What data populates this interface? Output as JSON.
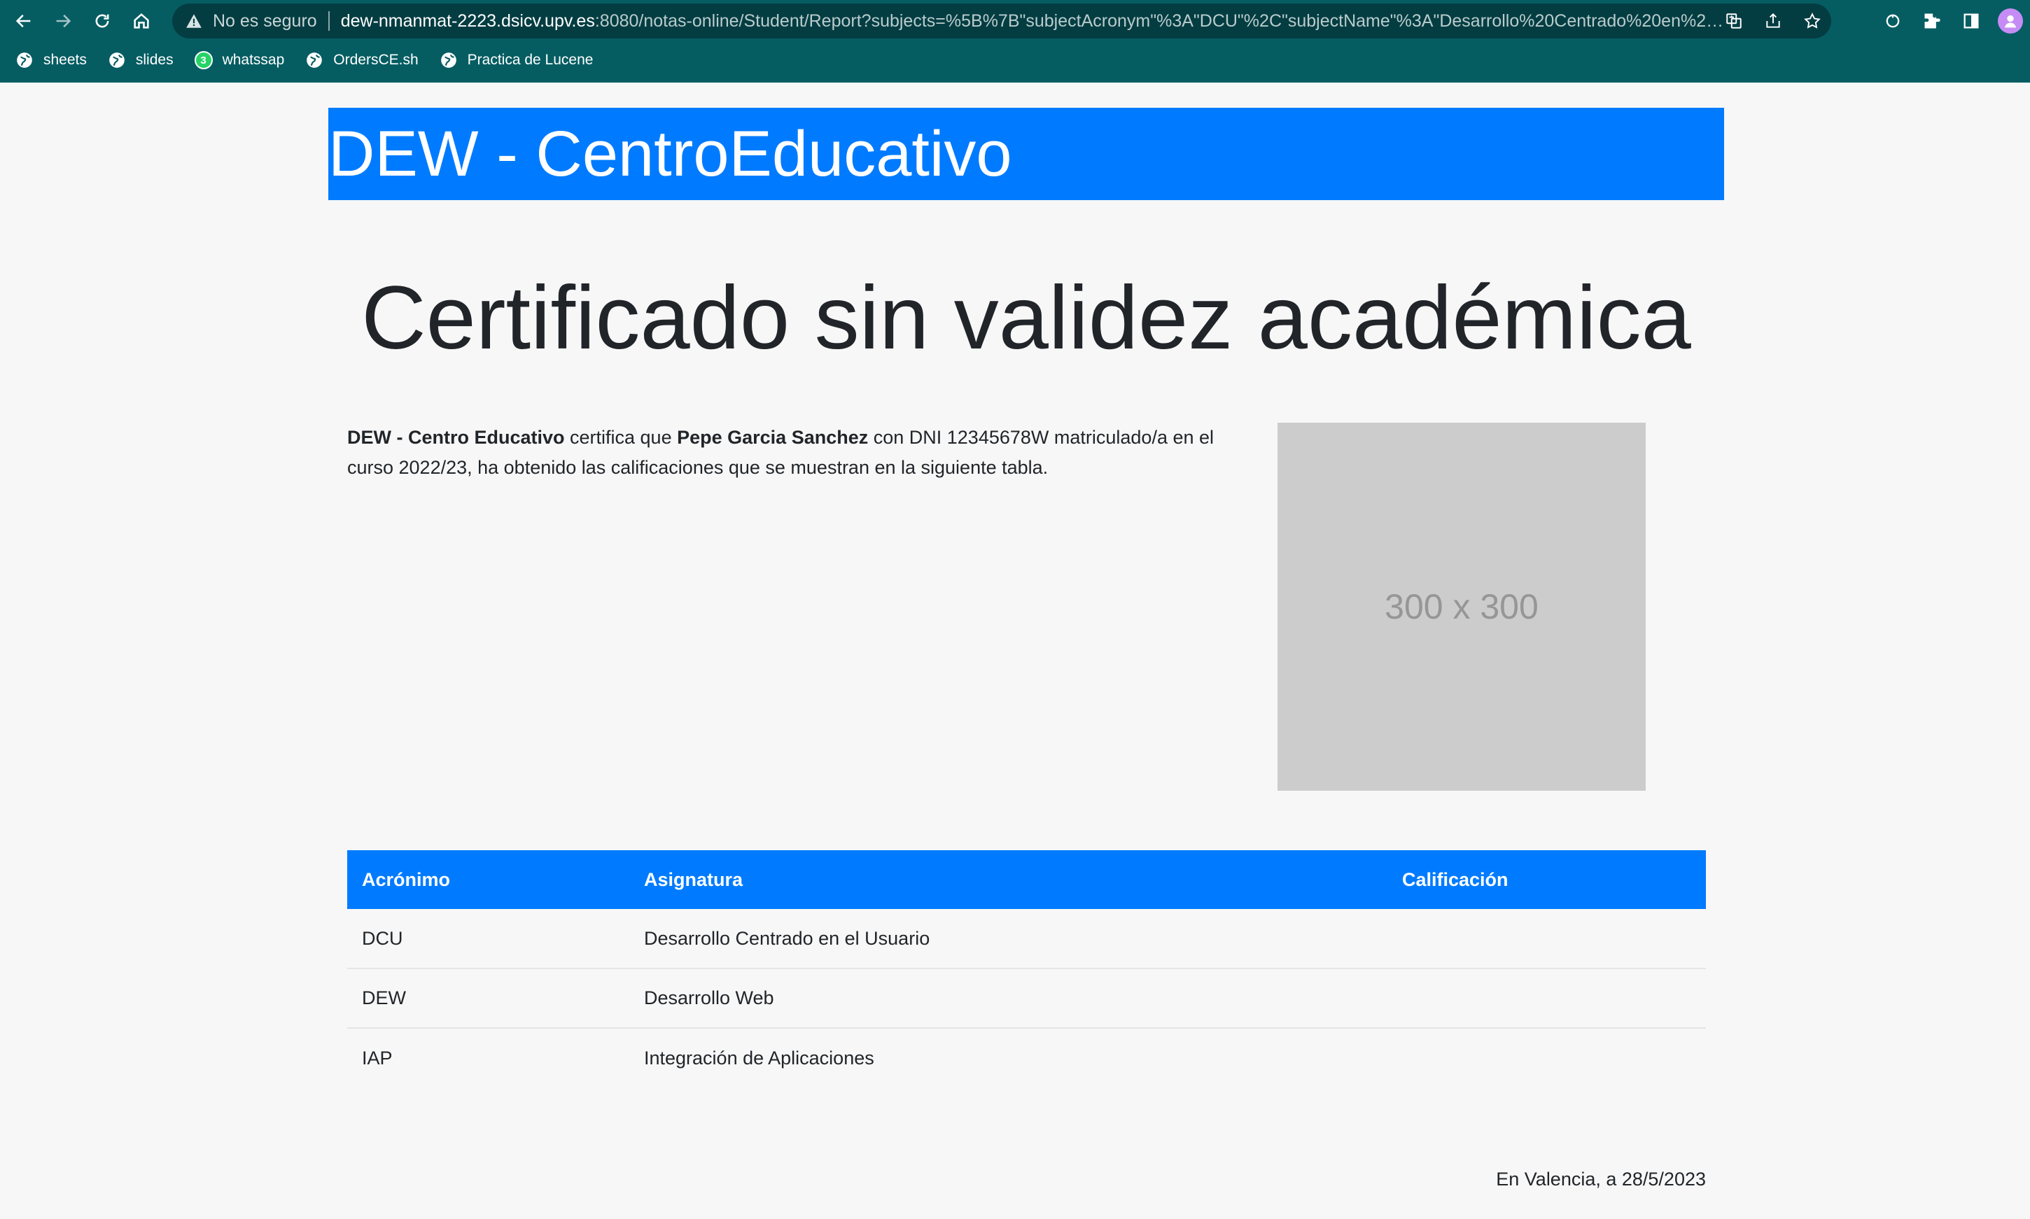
{
  "browser": {
    "security_label": "No es seguro",
    "url_host": "dew-nmanmat-2223.dsicv.upv.es",
    "url_path": ":8080/notas-online/Student/Report?subjects=%5B%7B\"subjectAcronym\"%3A\"DCU\"%2C\"subjectName\"%3A\"Desarrollo%20Centrado%20en%20el%20...",
    "bookmarks": [
      {
        "label": "sheets",
        "icon": "globe-icon"
      },
      {
        "label": "slides",
        "icon": "globe-icon"
      },
      {
        "label": "whatssap",
        "icon": "whatsapp-icon",
        "badge": "3"
      },
      {
        "label": "OrdersCE.sh",
        "icon": "globe-icon"
      },
      {
        "label": "Practica de Lucene",
        "icon": "globe-icon"
      }
    ],
    "chrome_color": "#055d62"
  },
  "page": {
    "brand": "DEW - CentroEducativo",
    "brand_color": "#007bff",
    "title": "Certificado sin validez académica",
    "intro": {
      "institution": "DEW - Centro Educativo",
      "text_1": " certifica que ",
      "student": "Pepe Garcia Sanchez",
      "text_2": " con DNI 12345678W matriculado/a en el curso 2022/23, ha obtenido las calificaciones que se muestran en la siguiente tabla."
    },
    "image_placeholder": "300 x 300",
    "table": {
      "headers": [
        "Acrónimo",
        "Asignatura",
        "Calificación"
      ],
      "rows": [
        {
          "acronym": "DCU",
          "subject": "Desarrollo Centrado en el Usuario",
          "grade": ""
        },
        {
          "acronym": "DEW",
          "subject": "Desarrollo Web",
          "grade": ""
        },
        {
          "acronym": "IAP",
          "subject": "Integración de Aplicaciones",
          "grade": ""
        }
      ]
    },
    "footer_date": "En Valencia, a 28/5/2023"
  }
}
